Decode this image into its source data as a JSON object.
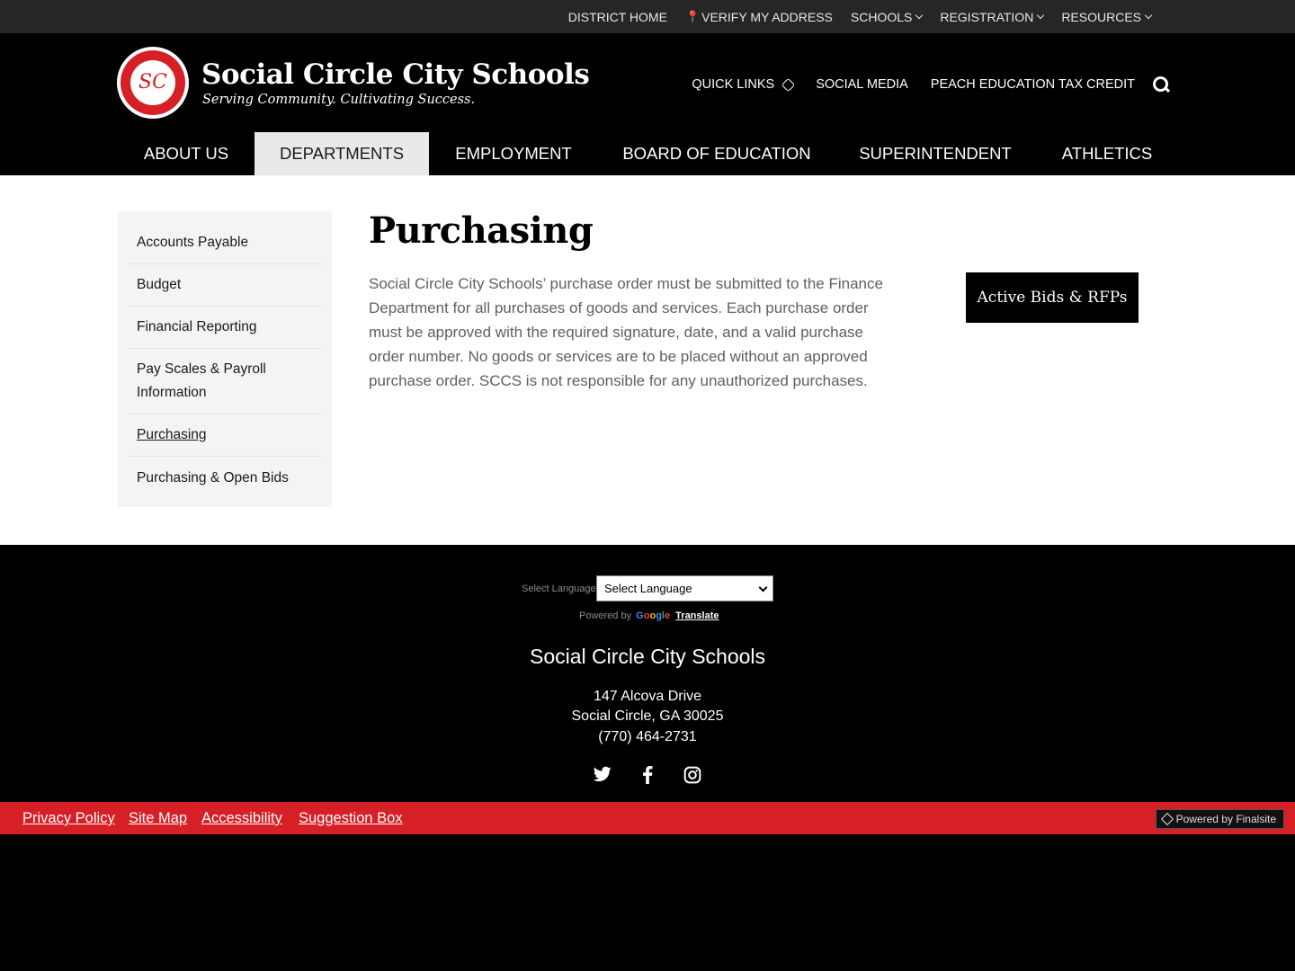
{
  "utility_nav": {
    "items": [
      {
        "label": "DISTRICT HOME"
      },
      {
        "label": "VERIFY MY ADDRESS"
      },
      {
        "label": "SCHOOLS"
      },
      {
        "label": "REGISTRATION"
      },
      {
        "label": "RESOURCES"
      }
    ]
  },
  "header": {
    "logo_letters": "SC",
    "school_name": "Social Circle City Schools",
    "tagline": "Serving Community. Cultivating Success.",
    "links": [
      {
        "label": "QUICK LINKS"
      },
      {
        "label": "SOCIAL MEDIA"
      },
      {
        "label": "PEACH EDUCATION TAX CREDIT"
      }
    ]
  },
  "main_nav": {
    "items": [
      {
        "label": "ABOUT US"
      },
      {
        "label": "DEPARTMENTS"
      },
      {
        "label": "EMPLOYMENT"
      },
      {
        "label": "BOARD OF EDUCATION"
      },
      {
        "label": "SUPERINTENDENT"
      },
      {
        "label": "ATHLETICS"
      }
    ],
    "active": "DEPARTMENTS"
  },
  "sidebar": {
    "items": [
      {
        "label": "Accounts Payable"
      },
      {
        "label": "Budget"
      },
      {
        "label": "Financial Reporting"
      },
      {
        "label": "Pay Scales & Payroll Information"
      },
      {
        "label": "Purchasing"
      },
      {
        "label": "Purchasing & Open Bids"
      }
    ],
    "current": "Purchasing"
  },
  "page": {
    "title": "Purchasing",
    "body": "Social Circle City Schools’ purchase order must be submitted to the Finance Department for all purchases of goods and services.  Each purchase order must be approved with the required signature, date, and a valid purchase order number.  No goods or services are to be placed without an approved purchase order.  SCCS is not responsible for any unauthorized purchases.",
    "cta_label": "Active Bids & RFPs"
  },
  "footer": {
    "language_label": "Select Language",
    "language_selected": "Select Language",
    "powered_by": "Powered by",
    "google": "Google",
    "translate": "Translate",
    "org_name": "Social Circle City Schools",
    "address_line1": "147 Alcova Drive",
    "address_line2": "Social Circle, GA  30025",
    "phone": "(770) 464-2731",
    "social_icons": [
      "twitter-icon",
      "facebook-icon",
      "instagram-icon"
    ]
  },
  "bottom_bar": {
    "links": [
      {
        "label": "Privacy Policy"
      },
      {
        "label": "Site Map"
      },
      {
        "label": "Accessibility"
      },
      {
        "label": "Suggestion Box"
      }
    ],
    "powered_badge": "Powered by Finalsite"
  },
  "colors": {
    "brand_red": "#d71f26",
    "black": "#000000",
    "utility_bar": "#262626",
    "active_tab": "#e9e9e9"
  }
}
